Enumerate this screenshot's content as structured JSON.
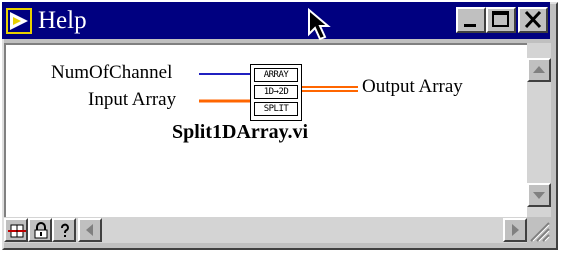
{
  "window": {
    "title": "Help",
    "colors": {
      "titlebar": "#000080",
      "face": "#c0c0c0",
      "client": "#ffffff"
    }
  },
  "diagram": {
    "terminals": {
      "num_of_channel": "NumOfChannel",
      "input_array": "Input Array",
      "output_array": "Output Array"
    },
    "node_text": [
      "ARRAY",
      "1D→2D",
      "SPLIT"
    ],
    "vi_name": "Split1DArray.vi",
    "wire_colors": {
      "int": "#2020c0",
      "array": "#ff6600"
    }
  },
  "toolbar": {
    "icons": [
      "block-diagram-icon",
      "lock-icon",
      "help-question-icon"
    ]
  }
}
